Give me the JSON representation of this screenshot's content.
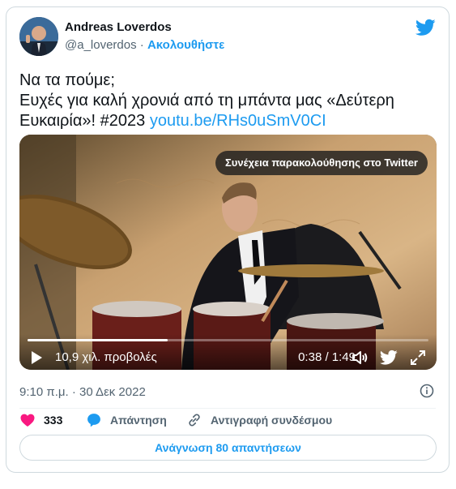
{
  "author": {
    "name": "Andreas Loverdos",
    "handle": "@a_loverdos",
    "separator": "·",
    "follow_label": "Ακολουθήστε"
  },
  "tweet": {
    "line1": "Να τα πούμε;",
    "line2": "Ευχές για καλή χρονιά από τη μπάντα μας «Δεύτερη",
    "line3_text": "Ευκαιρία»! #2023 ",
    "link": "youtu.be/RHs0uSmV0CI"
  },
  "video": {
    "overlay_label": "Συνέχεια παρακολούθησης στο Twitter",
    "views": "10,9 χιλ. προβολές",
    "time": "0:38 / 1:49",
    "progress": 0.35
  },
  "meta": {
    "datetime": "9:10 π.μ. · 30 Δεκ 2022"
  },
  "actions": {
    "likes": "333",
    "reply_label": "Απάντηση",
    "copy_link_label": "Αντιγραφή συνδέσμου"
  },
  "read_replies_label": "Ανάγνωση 80 απαντήσεων",
  "colors": {
    "accent": "#1d9bf0",
    "like": "#f91880",
    "text": "#0f1419",
    "secondary": "#536471"
  },
  "icons": [
    "twitter-bird-icon",
    "play-icon",
    "volume-icon",
    "twitter-logo-icon",
    "fullscreen-icon",
    "info-icon",
    "heart-icon",
    "reply-bubble-icon",
    "link-icon"
  ]
}
